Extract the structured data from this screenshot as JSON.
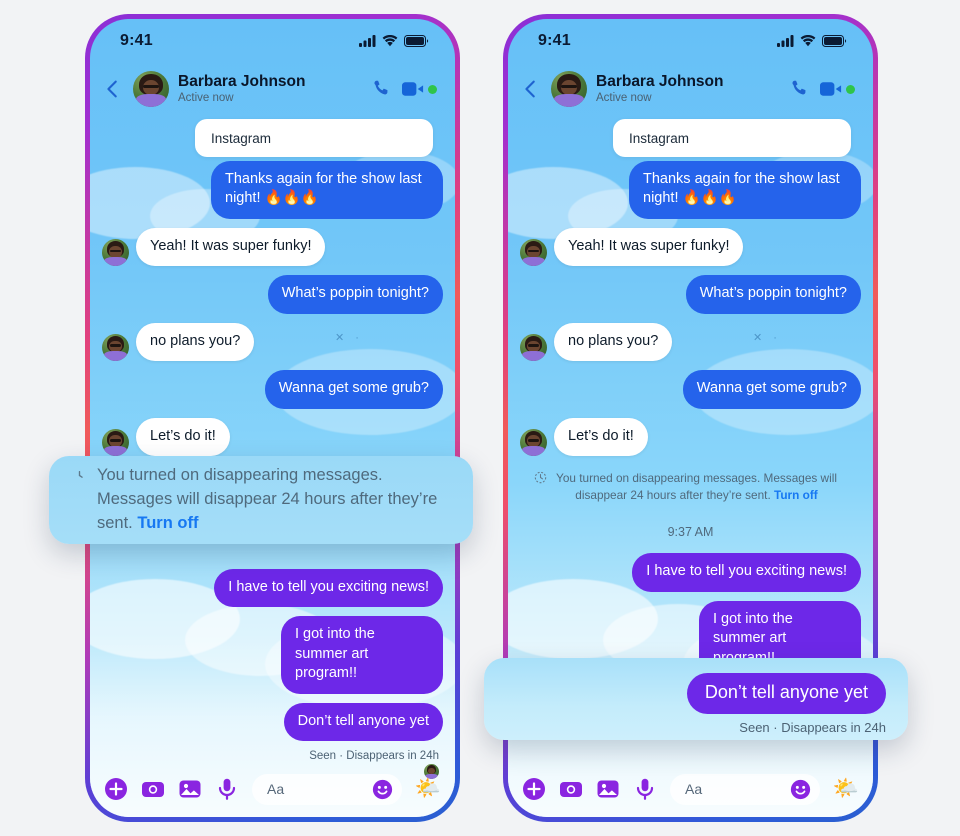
{
  "phones": [
    {
      "id": "left",
      "status_bar": {
        "time": "9:41",
        "icons": [
          "signal-icon",
          "wifi-icon",
          "battery-icon"
        ]
      },
      "header": {
        "back_label": "Back",
        "contact_name": "Barbara Johnson",
        "presence": "Active now",
        "call_icon": "phone-call-icon",
        "video_icon": "video-call-icon"
      },
      "top_card_label": "Instagram",
      "messages": [
        {
          "side": "out",
          "style": "blue",
          "text": "Thanks again for the show last night! 🔥🔥🔥"
        },
        {
          "side": "in",
          "style": "white",
          "text": "Yeah! It was super funky!"
        },
        {
          "side": "out",
          "style": "blue",
          "text": "What’s poppin tonight?"
        },
        {
          "side": "in",
          "style": "white",
          "text": "no plans you?"
        },
        {
          "side": "out",
          "style": "blue",
          "text": "Wanna get some grub?"
        },
        {
          "side": "in",
          "style": "white",
          "text": "Let’s do it!"
        }
      ],
      "notice": {
        "icon": "disappearing-timer-icon",
        "text": "You turned on disappearing messages. Messages will disappear 24 hours after they’re sent.",
        "action_label": "Turn off",
        "shown_inline": false
      },
      "timestamp": "",
      "messages_after": [
        {
          "side": "out",
          "style": "purple",
          "text": "I have to tell you exciting news!"
        },
        {
          "side": "out",
          "style": "purple",
          "text": "I got into the summer art program!!"
        },
        {
          "side": "out",
          "style": "purple",
          "text": "Don’t tell anyone yet"
        }
      ],
      "seen_status": "Seen · Disappears in 24h",
      "toolbar": {
        "icons": [
          "plus-icon",
          "camera-icon",
          "gallery-icon",
          "microphone-icon"
        ],
        "composer_placeholder": "Aa",
        "emoji_icon": "smiley-icon",
        "sticker_icon": "weather-sticker-icon"
      },
      "magnifier": {
        "kind": "notice",
        "icon": "disappearing-timer-icon",
        "text": "You turned on disappearing messages. Messages will disappear 24 hours after they’re sent.",
        "action_label": "Turn off"
      }
    },
    {
      "id": "right",
      "status_bar": {
        "time": "9:41",
        "icons": [
          "signal-icon",
          "wifi-icon",
          "battery-icon"
        ]
      },
      "header": {
        "back_label": "Back",
        "contact_name": "Barbara Johnson",
        "presence": "Active now",
        "call_icon": "phone-call-icon",
        "video_icon": "video-call-icon"
      },
      "top_card_label": "Instagram",
      "messages": [
        {
          "side": "out",
          "style": "blue",
          "text": "Thanks again for the show last night! 🔥🔥🔥"
        },
        {
          "side": "in",
          "style": "white",
          "text": "Yeah! It was super funky!"
        },
        {
          "side": "out",
          "style": "blue",
          "text": "What’s poppin tonight?"
        },
        {
          "side": "in",
          "style": "white",
          "text": "no plans you?"
        },
        {
          "side": "out",
          "style": "blue",
          "text": "Wanna get some grub?"
        },
        {
          "side": "in",
          "style": "white",
          "text": "Let’s do it!"
        }
      ],
      "notice": {
        "icon": "disappearing-timer-icon",
        "text": "You turned on disappearing messages. Messages will disappear 24 hours after they’re sent.",
        "action_label": "Turn off",
        "shown_inline": true
      },
      "timestamp": "9:37 AM",
      "messages_after": [
        {
          "side": "out",
          "style": "purple",
          "text": "I have to tell you exciting news!"
        },
        {
          "side": "out",
          "style": "purple",
          "text": "I got into the summer art program!!"
        },
        {
          "side": "out",
          "style": "purple",
          "text": "Don’t tell anyone yet"
        }
      ],
      "seen_status": "Seen · Disappears in 24h",
      "toolbar": {
        "icons": [
          "plus-icon",
          "camera-icon",
          "gallery-icon",
          "microphone-icon"
        ],
        "composer_placeholder": "Aa",
        "emoji_icon": "smiley-icon",
        "sticker_icon": "weather-sticker-icon"
      },
      "magnifier": {
        "kind": "bubble",
        "bubble_text": "Don’t tell anyone yet",
        "seen_status": "Seen · Disappears in 24h"
      }
    }
  ],
  "colors": {
    "bubble_blue": "#2563EB",
    "bubble_purple": "#6D28E8",
    "bubble_white": "#FFFFFF",
    "link_blue": "#1778F2",
    "sky": "#72C7F8",
    "page_bg": "#F2F3F5",
    "online_green": "#2FC44A"
  }
}
